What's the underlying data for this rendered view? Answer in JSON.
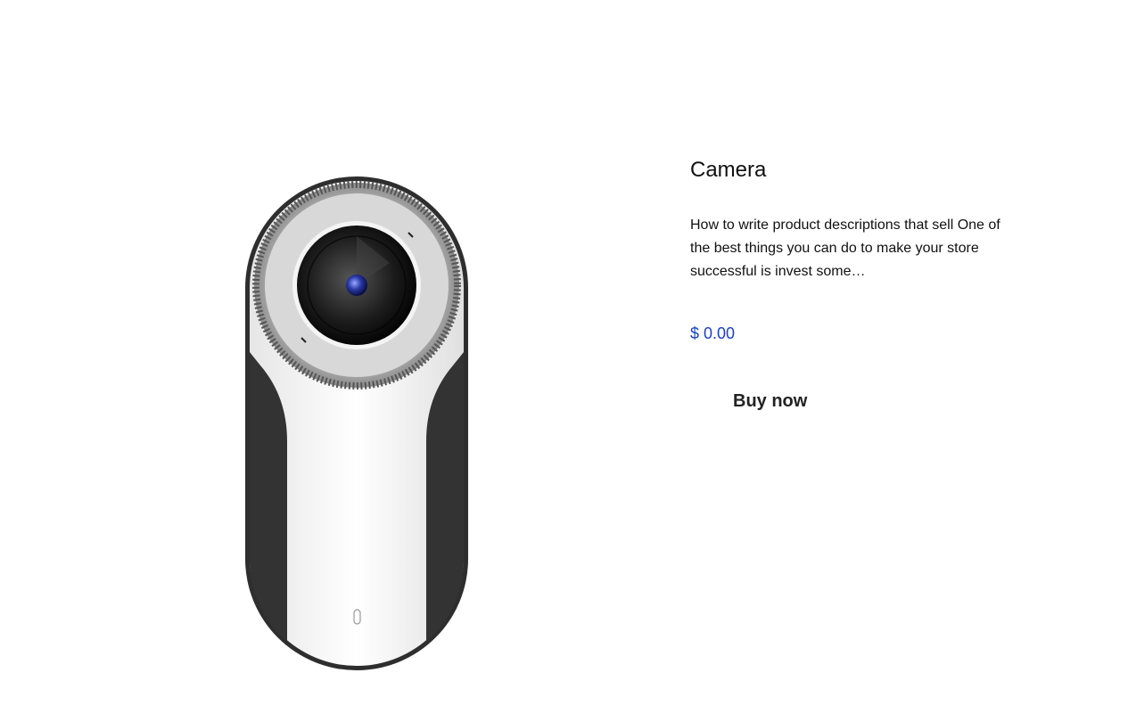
{
  "product": {
    "name": "Camera",
    "description": "How to write product descriptions that sell One of the best things you can do to make your store successful is invest some…",
    "price": "$ 0.00",
    "buy_label": "Buy now"
  },
  "colors": {
    "price": "#1a3fc4",
    "text": "#111111",
    "button_text": "#222222",
    "background": "#ffffff"
  },
  "icons": {
    "product_image": "camera-360-device"
  }
}
